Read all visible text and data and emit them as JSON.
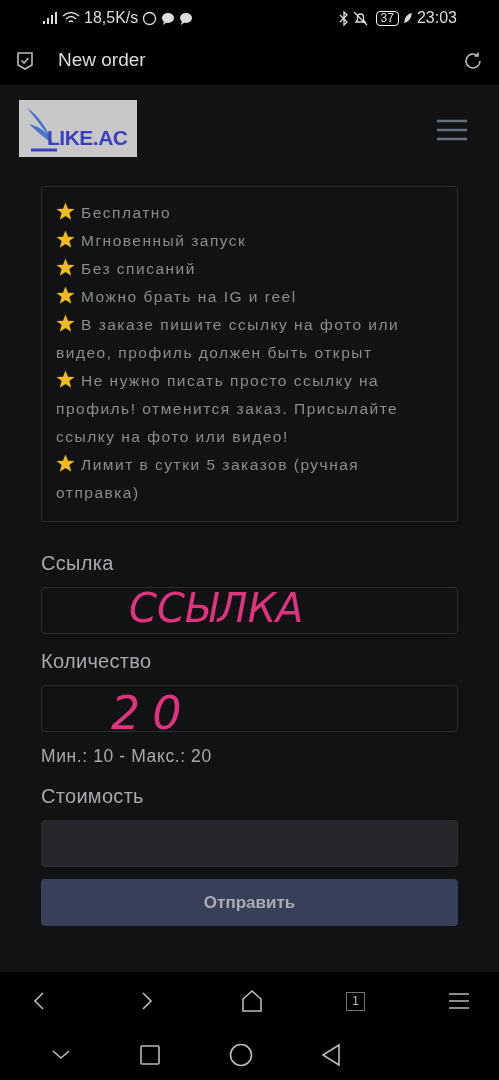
{
  "status_bar": {
    "speed": "18,5K/s",
    "battery": "37",
    "time": "23:03"
  },
  "app_bar": {
    "title": "New order"
  },
  "logo": {
    "text": "LIKE.AC"
  },
  "features": [
    {
      "text": "Бесплатно"
    },
    {
      "text": "Мгновенный запуск"
    },
    {
      "text": "Без списаний"
    },
    {
      "text": "Можно брать на IG и reel"
    },
    {
      "text": "В заказе пишите ссылку на фото или видео, профиль должен быть открыт"
    },
    {
      "text": "Не нужно писать просто ссылку на профиль! отменится заказ. Присылайте ссылку на фото или видео!"
    },
    {
      "text": "Лимит в сутки 5 заказов (ручная отправка)"
    }
  ],
  "form": {
    "fields": [
      {
        "label": "Ссылка",
        "handwriting": "ССЫЛКА",
        "disabled": false
      },
      {
        "label": "Количество",
        "handwriting": "20",
        "hint": "Мин.: 10 - Макс.: 20",
        "disabled": false
      },
      {
        "label": "Стоимость",
        "disabled": true
      }
    ],
    "submit": "Отправить"
  },
  "browser_bar": {
    "tabs_count": "1"
  }
}
